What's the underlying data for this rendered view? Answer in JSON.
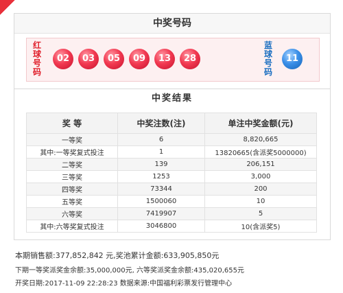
{
  "winning_numbers": {
    "title": "中奖号码",
    "red_label": [
      "红",
      "球",
      "号",
      "码"
    ],
    "blue_label": [
      "蓝",
      "球",
      "号",
      "码"
    ],
    "red_balls": [
      "02",
      "03",
      "05",
      "09",
      "13",
      "28"
    ],
    "blue_ball": "11",
    "colors": {
      "red": "#e0202c",
      "blue": "#1b6fc1"
    }
  },
  "results": {
    "title": "中奖结果",
    "headers": [
      "奖 等",
      "中奖注数(注)",
      "单注中奖金额(元)"
    ],
    "rows": [
      [
        "一等奖",
        "6",
        "8,820,665"
      ],
      [
        "其中:一等奖复式投注",
        "1",
        "13820665(含派奖5000000)"
      ],
      [
        "二等奖",
        "139",
        "206,151"
      ],
      [
        "三等奖",
        "1253",
        "3,000"
      ],
      [
        "四等奖",
        "73344",
        "200"
      ],
      [
        "五等奖",
        "1500060",
        "10"
      ],
      [
        "六等奖",
        "7419907",
        "5"
      ],
      [
        "其中:六等奖复式投注",
        "3046800",
        "10(含派奖5)"
      ]
    ]
  },
  "summary": {
    "line1": "本期销售额:377,852,842 元,奖池累计金额:633,905,850元",
    "line2": "下期一等奖派奖金余额:35,000,000元, 六等奖派奖金余额:435,020,655元",
    "line3": "开奖日期:2017-11-09 22:28:23  数据来源:中国福利彩票发行管理中心"
  }
}
